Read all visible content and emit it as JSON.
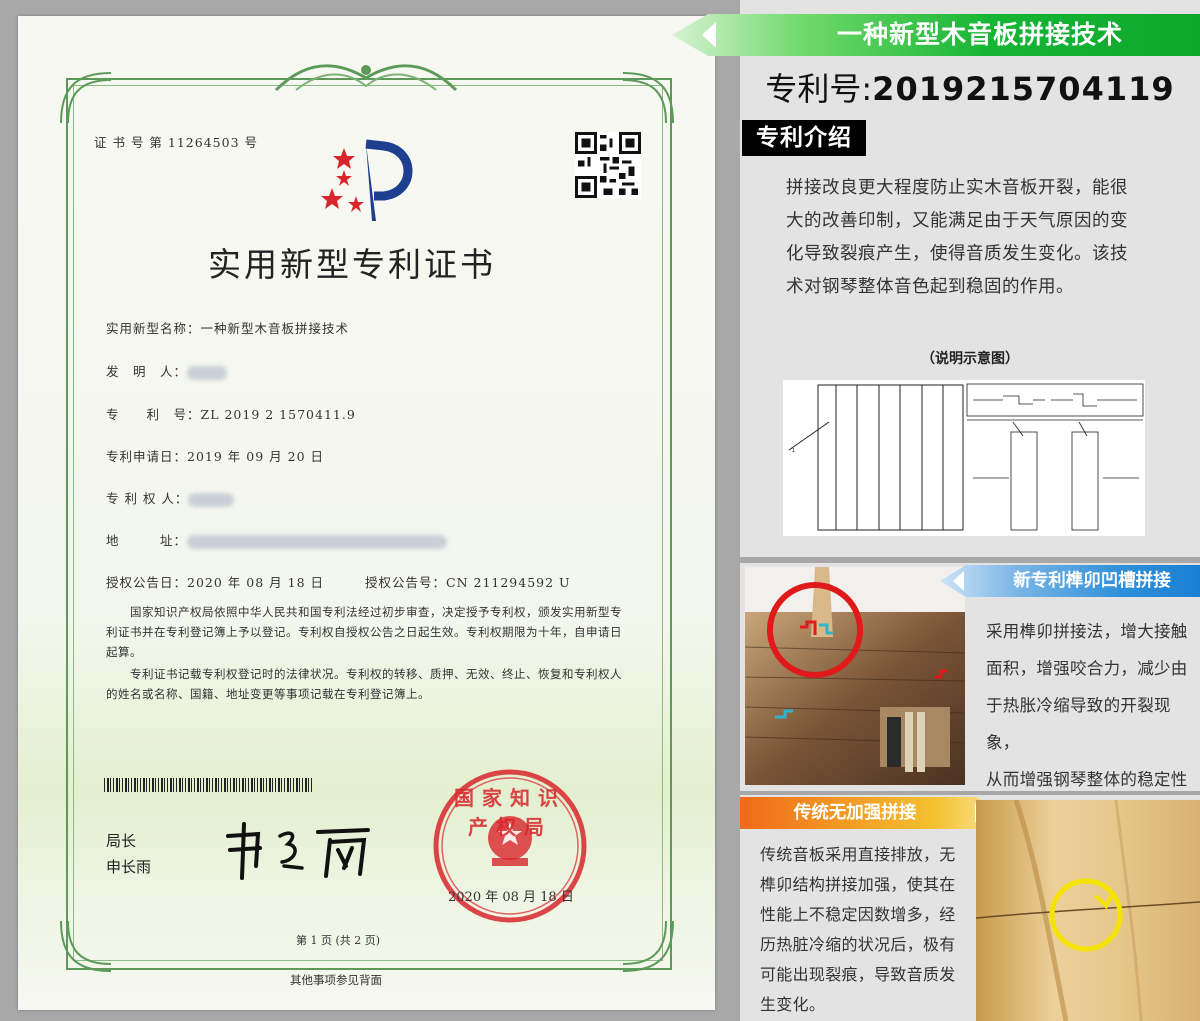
{
  "certificate": {
    "cert_no": "证 书 号 第 11264503 号",
    "title": "实用新型专利证书",
    "fields": {
      "name_label": "实用新型名称：",
      "name_value": "一种新型木音板拼接技术",
      "inventor_label": "发　明　人：",
      "patent_label": "专　　利　号：",
      "patent_value": "ZL 2019 2 1570411.9",
      "apply_date_label": "专利申请日：",
      "apply_date_value": "2019 年 09 月 20 日",
      "owner_label": "专 利 权 人：",
      "address_label": "地　　　址：",
      "grant_date_label": "授权公告日：",
      "grant_date_value": "2020 年 08 月 18 日",
      "grant_no_label": "授权公告号：",
      "grant_no_value": "CN 211294592 U"
    },
    "body_p1": "国家知识产权局依照中华人民共和国专利法经过初步审查，决定授予专利权，颁发实用新型专利证书并在专利登记簿上予以登记。专利权自授权公告之日起生效。专利权期限为十年，自申请日起算。",
    "body_p2": "专利证书记载专利权登记时的法律状况。专利权的转移、质押、无效、终止、恢复和专利权人的姓名或名称、国籍、地址变更等事项记载在专利登记簿上。",
    "director_title": "局长",
    "director_name": "申长雨",
    "seal_text": "国家知识产权局",
    "seal_date": "2020 年 08 月 18 日",
    "page_info": "第 1 页 (共 2 页)",
    "footer": "其他事项参见背面"
  },
  "panel": {
    "title": "一种新型木音板拼接技术",
    "patent_no_label": "专利号:",
    "patent_no_value": "2019215704119",
    "intro_tag": "专利介绍",
    "intro_lines": [
      "拼接改良更大程度防止实木音板开裂，能很",
      "大的改善印制，又能满足由于天气原因的变",
      "化导致裂痕产生，使得音质发生变化。该技",
      "术对钢琴整体音色起到稳固的作用。"
    ],
    "diagram_title": "（说明示意图）",
    "mid_title": "新专利榫卯凹槽拼接",
    "mid_lines": [
      "采用榫卯拼接法，增大接触",
      "面积，增强咬合力，减少由",
      "于热胀冷缩导致的开裂现象，",
      "从而增强钢琴整体的稳定性"
    ],
    "bot_title": "传统无加强拼接",
    "bot_lines": [
      "传统音板采用直接排放，无",
      "榫卯结构拼接加强，使其在",
      "性能上不稳定因数增多，经",
      "历热脏冷缩的状况后，极有",
      "可能出现裂痕，导致音质发",
      "生变化。"
    ]
  },
  "colors": {
    "green_banner": "#16b534",
    "blue_banner": "#1a80d3",
    "orange_banner": "#f06a1a",
    "seal_red": "#d8262c",
    "frame_green": "#5d9a5a"
  }
}
